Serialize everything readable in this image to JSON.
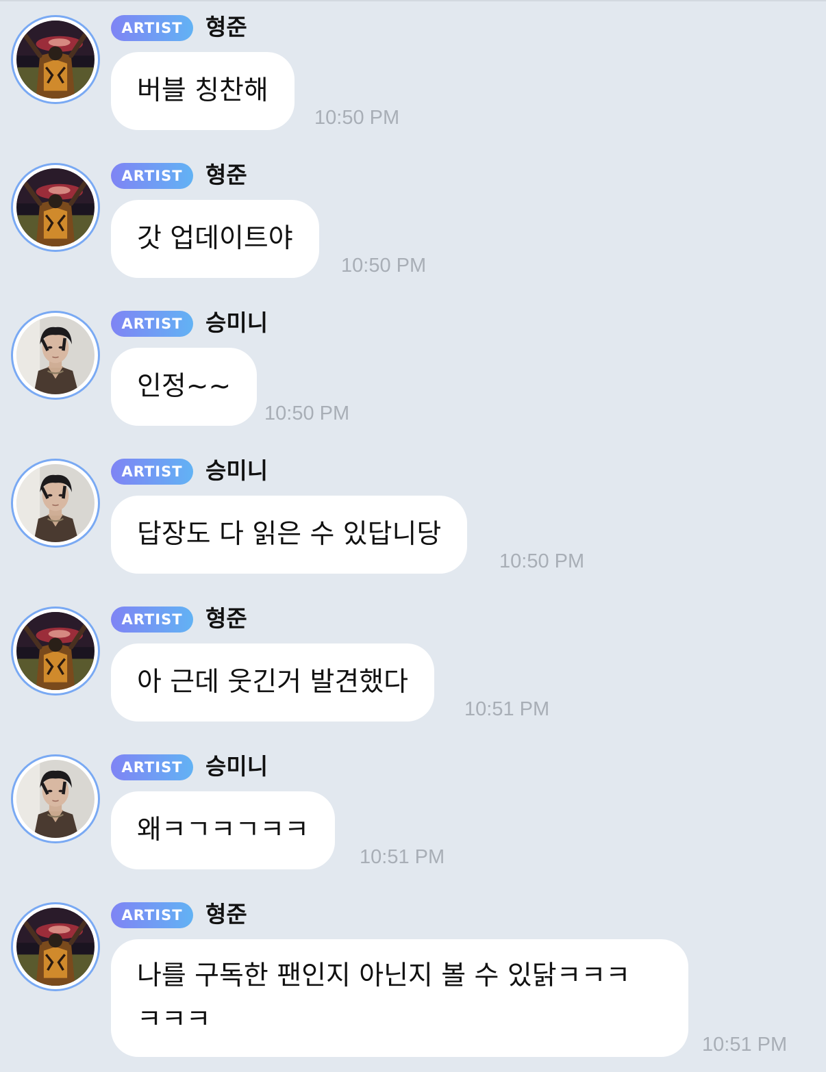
{
  "messages": [
    {
      "badge": "ARTIST",
      "sender": "형준",
      "avatar": "hyungjun-avatar",
      "text": "버블 칭찬해",
      "time": "10:50 PM"
    },
    {
      "badge": "ARTIST",
      "sender": "형준",
      "avatar": "hyungjun-avatar",
      "text": "갓 업데이트야",
      "time": "10:50 PM"
    },
    {
      "badge": "ARTIST",
      "sender": "승미니",
      "avatar": "seungmin-avatar",
      "text": "인정~~",
      "time": "10:50 PM"
    },
    {
      "badge": "ARTIST",
      "sender": "승미니",
      "avatar": "seungmin-avatar",
      "text": "답장도 다 읽은 수 있답니당",
      "time": "10:50 PM"
    },
    {
      "badge": "ARTIST",
      "sender": "형준",
      "avatar": "hyungjun-avatar",
      "text": "아 근데 웃긴거 발견했다",
      "time": "10:51 PM"
    },
    {
      "badge": "ARTIST",
      "sender": "승미니",
      "avatar": "seungmin-avatar",
      "text": "왜ㅋㄱㅋㄱㅋㅋ",
      "time": "10:51 PM"
    },
    {
      "badge": "ARTIST",
      "sender": "형준",
      "avatar": "hyungjun-avatar",
      "text_line1": "나를 구독한 팬인지 아닌지 볼 수 있닭ㅋㅋㅋ",
      "text_line2": "ㅋㅋㅋ",
      "time": "10:51 PM"
    }
  ]
}
